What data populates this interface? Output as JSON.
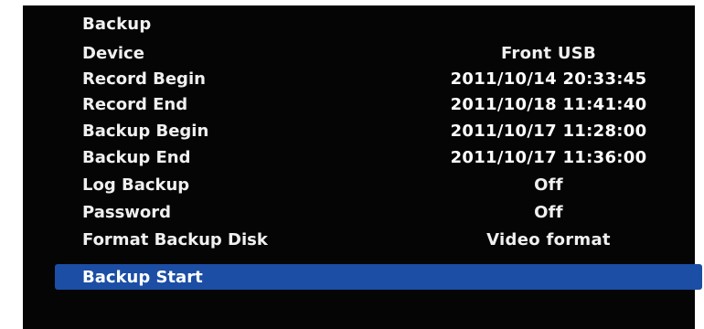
{
  "menu": {
    "title": "Backup",
    "rows": [
      {
        "label": "Device",
        "value": "Front USB"
      },
      {
        "label": "Record Begin",
        "value": "2011/10/14 20:33:45"
      },
      {
        "label": "Record End",
        "value": "2011/10/18 11:41:40"
      },
      {
        "label": "Backup Begin",
        "value": "2011/10/17 11:28:00"
      },
      {
        "label": "Backup End",
        "value": "2011/10/17 11:36:00"
      },
      {
        "label": "Log Backup",
        "value": "Off"
      },
      {
        "label": "Password",
        "value": "Off"
      },
      {
        "label": "Format Backup Disk",
        "value": "Video format"
      }
    ],
    "start_label": "Backup Start"
  },
  "colors": {
    "background": "#050505",
    "text": "#f0f0f0",
    "selection": "#1b4ea4"
  }
}
